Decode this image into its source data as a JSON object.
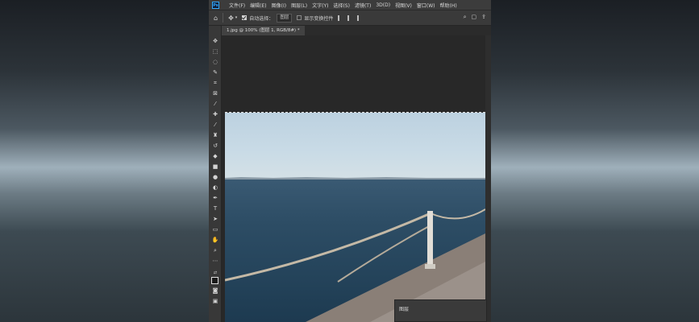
{
  "app": {
    "logo_text": "Ps"
  },
  "menubar": {
    "items": [
      "文件(F)",
      "编辑(E)",
      "图像(I)",
      "图层(L)",
      "文字(Y)",
      "选择(S)",
      "滤镜(T)",
      "3D(D)",
      "视图(V)",
      "窗口(W)",
      "帮助(H)"
    ]
  },
  "options_bar": {
    "auto_select_label": "自动选择：",
    "auto_select_value": "图层",
    "show_transform_label": "显示变换控件"
  },
  "document": {
    "tab_title": "1.jpg @ 100% (图层 1, RGB/8#) *"
  },
  "panels": {
    "layers_title": "图层"
  },
  "icons": {
    "home": "home-icon",
    "move": "move-icon",
    "search": "search-icon"
  }
}
